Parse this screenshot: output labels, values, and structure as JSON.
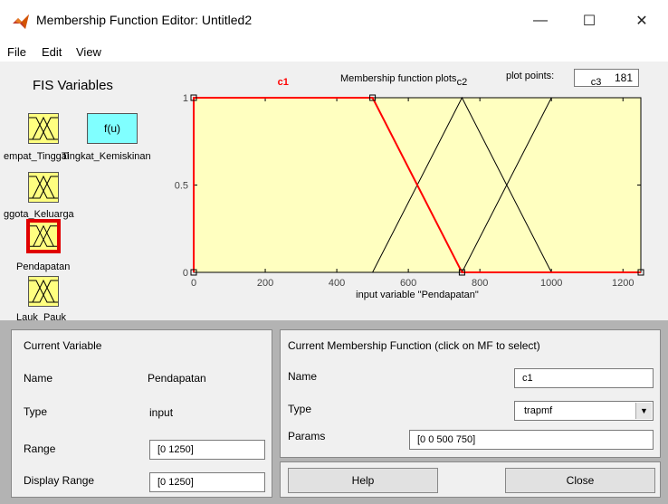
{
  "window": {
    "title": "Membership Function Editor: Untitled2",
    "minimize_glyph": "—",
    "maximize_glyph": "☐",
    "close_glyph": "✕"
  },
  "menu": [
    "File",
    "Edit",
    "View"
  ],
  "fis_panel": {
    "title": "FIS Variables",
    "fu_label": "f(u)",
    "labels": {
      "var1": "empat_Tinggal",
      "output": "Tingkat_Kemiskinan",
      "var2": "ggota_Keluarga",
      "var3": "Pendapatan",
      "var4": "Lauk_Pauk"
    }
  },
  "plot": {
    "section_label": "Membership function plots",
    "plot_points_label": "plot points:",
    "plot_points_value": "181",
    "selected_mf": "c1",
    "colors": {
      "background": "#ffffc0",
      "selected": "#ff0000",
      "normal": "#000000"
    },
    "chart_data": {
      "type": "line",
      "xlabel": "input variable \"Pendapatan\"",
      "xlim": [
        0,
        1250
      ],
      "ylim": [
        0,
        1
      ],
      "xticks": [
        0,
        200,
        400,
        600,
        800,
        1000,
        1200
      ],
      "yticks": [
        0,
        0.5,
        1
      ],
      "ytick_labels": [
        "0",
        "0.5",
        "1"
      ],
      "series": [
        {
          "name": "c1",
          "x": [
            0,
            0,
            500,
            750,
            1250
          ],
          "y": [
            0,
            1,
            1,
            0,
            0
          ]
        },
        {
          "name": "c2",
          "x": [
            0,
            500,
            750,
            1000,
            1250
          ],
          "y": [
            0,
            0,
            1,
            0,
            0
          ]
        },
        {
          "name": "c3",
          "x": [
            0,
            750,
            1000,
            1250
          ],
          "y": [
            0,
            0,
            1,
            1
          ]
        }
      ]
    }
  },
  "current_variable": {
    "title": "Current Variable",
    "name_label": "Name",
    "name_value": "Pendapatan",
    "type_label": "Type",
    "type_value": "input",
    "range_label": "Range",
    "range_value": "[0 1250]",
    "display_range_label": "Display Range",
    "display_range_value": "[0 1250]"
  },
  "current_mf": {
    "title": "Current Membership Function (click on MF to select)",
    "name_label": "Name",
    "name_value": "c1",
    "type_label": "Type",
    "type_value": "trapmf",
    "params_label": "Params",
    "params_value": "[0 0 500 750]"
  },
  "buttons": {
    "help": "Help",
    "close": "Close"
  }
}
